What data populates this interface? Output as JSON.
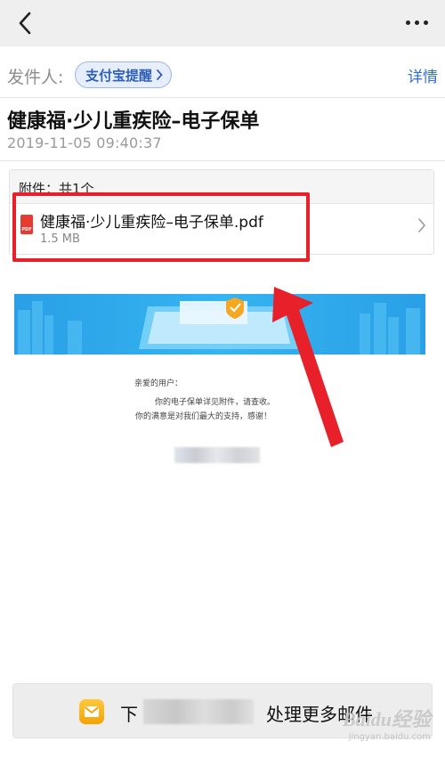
{
  "nav": {
    "back_icon": "chevron-left-icon",
    "more_icon": "more-dots-icon"
  },
  "sender": {
    "label": "发件人:",
    "name": "支付宝提醒",
    "details": "详情"
  },
  "mail": {
    "subject": "健康福·少儿重疾险–电子保单",
    "date": "2019-11-05 09:40:37"
  },
  "attachments": {
    "count_label": "附件：共1个",
    "file": {
      "name": "健康福·少儿重疾险–电子保单.pdf",
      "size": "1.5 MB",
      "icon": "pdf-file-icon",
      "icon_text": "PDF"
    }
  },
  "body": {
    "greeting": "亲爱的用户：",
    "line1": "你的电子保单详见附件，请查收。",
    "line2": "你的满意是对我们最大的支持，感谢！"
  },
  "bottom_bar": {
    "prefix": "下",
    "suffix": "处理更多邮件",
    "icon": "mail-app-icon"
  },
  "watermark": {
    "logo": "Baidu经验",
    "url": "jingyan.baidu.com"
  },
  "colors": {
    "accent": "#2f6fd6",
    "highlight": "#e8202a",
    "chip_bg": "#e7eefb"
  }
}
